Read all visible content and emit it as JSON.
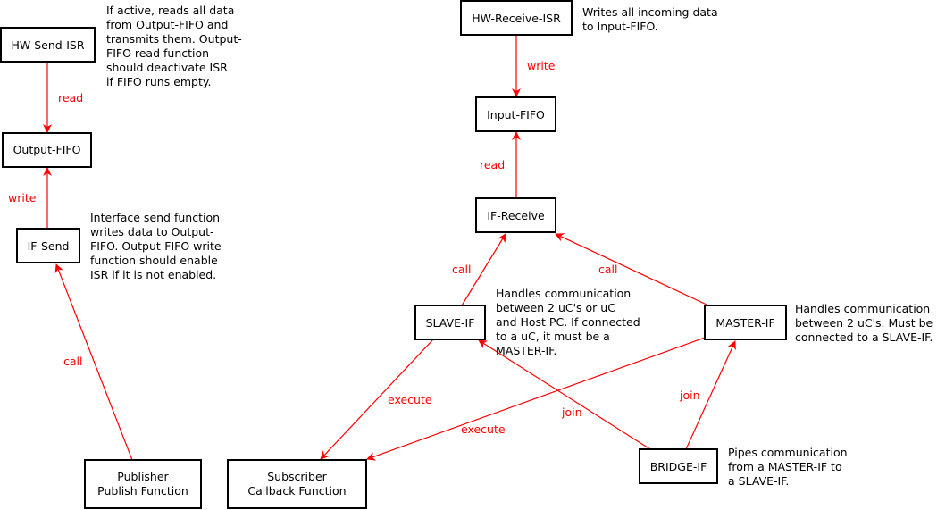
{
  "nodes": {
    "hw_send_isr": "HW-Send-ISR",
    "output_fifo": "Output-FIFO",
    "if_send": "IF-Send",
    "publisher": [
      "Publisher",
      "Publish Function"
    ],
    "subscriber": [
      "Subscriber",
      "Callback Function"
    ],
    "hw_receive_isr": "HW-Receive-ISR",
    "input_fifo": "Input-FIFO",
    "if_receive": "IF-Receive",
    "slave_if": "SLAVE-IF",
    "master_if": "MASTER-IF",
    "bridge_if": "BRIDGE-IF"
  },
  "edges": {
    "send_isr_read": "read",
    "if_send_write": "write",
    "publisher_call": "call",
    "receive_isr_write": "write",
    "if_receive_read": "read",
    "slave_call": "call",
    "master_call": "call",
    "slave_execute": "execute",
    "master_execute": "execute",
    "bridge_join_slave": "join",
    "bridge_join_master": "join"
  },
  "notes": {
    "hw_send_isr": [
      "If active, reads all data",
      "from Output-FIFO and",
      "transmits them. Output-",
      "FIFO read function",
      "should deactivate ISR",
      "if FIFO runs empty."
    ],
    "if_send": [
      "Interface send function",
      "writes data to Output-",
      "FIFO. Output-FIFO write",
      "function should enable",
      "ISR if it is not enabled."
    ],
    "hw_receive_isr": [
      "Writes all incoming data",
      "to Input-FIFO."
    ],
    "slave_if": [
      "Handles communication",
      "between 2 uC's or uC",
      "and Host PC. If connected",
      "to a uC, it must be a",
      "MASTER-IF."
    ],
    "master_if": [
      "Handles communication",
      "between 2 uC's. Must be",
      "connected to a SLAVE-IF."
    ],
    "bridge_if": [
      "Pipes communication",
      "from a MASTER-IF to",
      "a SLAVE-IF."
    ]
  },
  "colors": {
    "edge": "#ff0000",
    "box_border": "#000000"
  }
}
